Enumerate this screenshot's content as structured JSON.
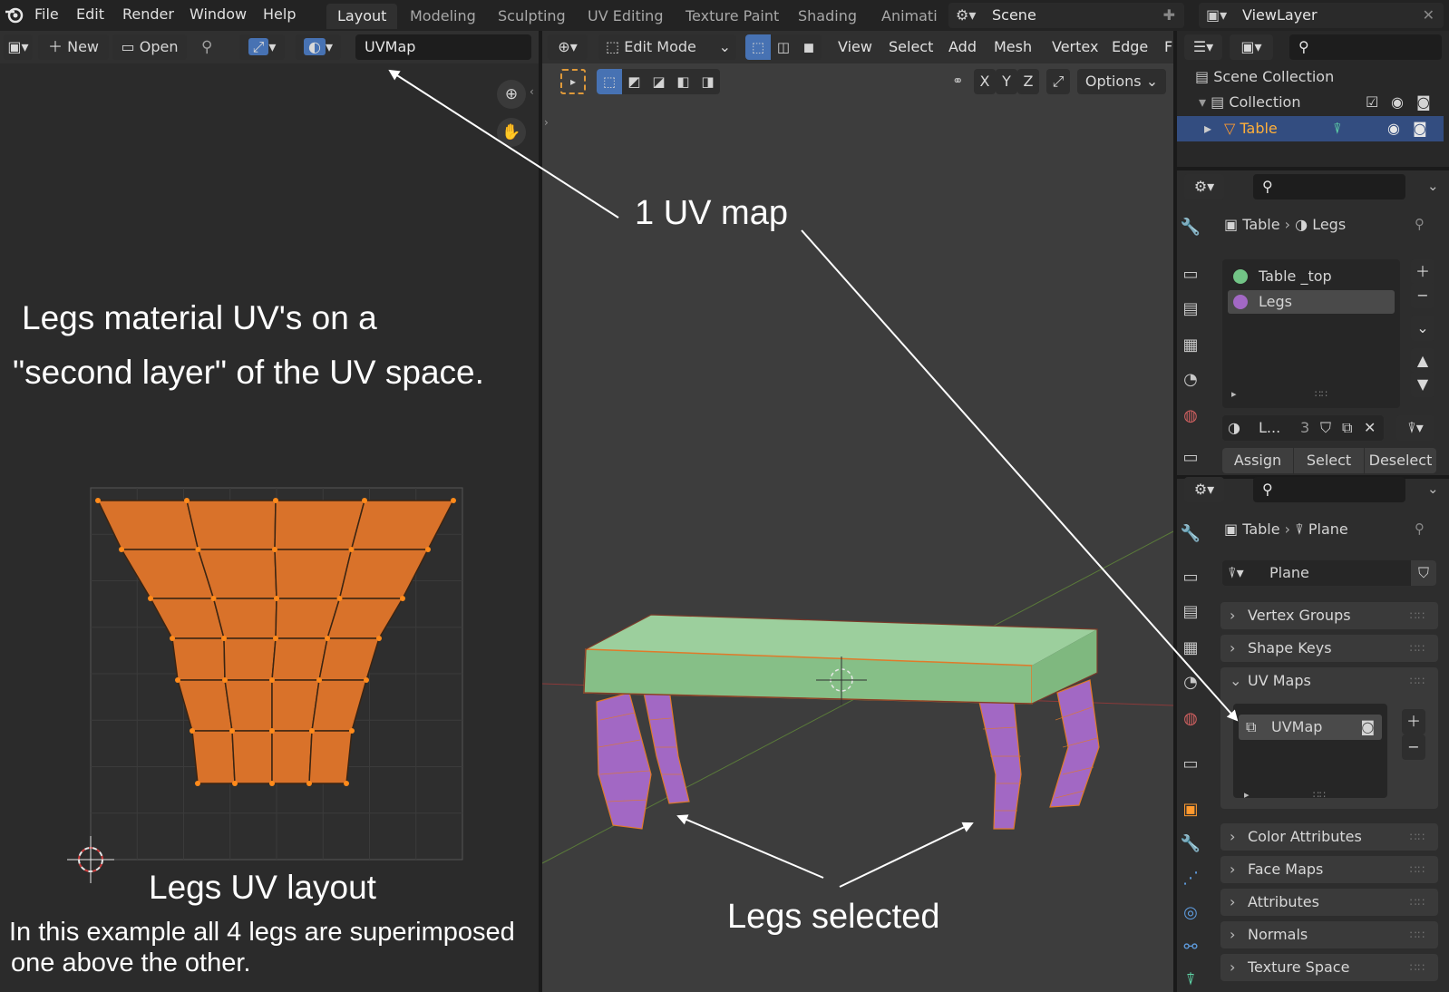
{
  "menu": {
    "file": "File",
    "edit": "Edit",
    "render": "Render",
    "window": "Window",
    "help": "Help"
  },
  "workspaces": [
    "Layout",
    "Modeling",
    "Sculpting",
    "UV Editing",
    "Texture Paint",
    "Shading",
    "Animati"
  ],
  "scene": {
    "label": "Scene"
  },
  "view_layer": {
    "label": "ViewLayer"
  },
  "uv_editor": {
    "new_label": "New",
    "open_label": "Open",
    "uvmap_name": "UVMap"
  },
  "viewport": {
    "mode": "Edit Mode",
    "menus": [
      "View",
      "Select",
      "Add",
      "Mesh",
      "Vertex",
      "Edge",
      "F"
    ],
    "axes": [
      "X",
      "Y",
      "Z"
    ],
    "options_label": "Options"
  },
  "outliner": {
    "scene_collection": "Scene Collection",
    "collection": "Collection",
    "object": "Table"
  },
  "material_panel": {
    "breadcrumb_object": "Table",
    "breadcrumb_material": "Legs",
    "slots": [
      "Table _top",
      "Legs"
    ],
    "material_short": "L...",
    "users": "3",
    "assign": "Assign",
    "select": "Select",
    "deselect": "Deselect"
  },
  "data_panel": {
    "breadcrumb_object": "Table",
    "breadcrumb_mesh": "Plane",
    "mesh_name": "Plane",
    "sections": [
      "Vertex Groups",
      "Shape Keys",
      "UV Maps",
      "Color Attributes",
      "Face Maps",
      "Attributes",
      "Normals",
      "Texture Space"
    ],
    "uv_map_item": "UVMap"
  },
  "annotations": {
    "uv_map_callout": "1 UV map",
    "legs_material_line1": "Legs material UV's on a",
    "legs_material_line2": "\"second layer\" of the UV space.",
    "legs_uv_layout": "Legs UV layout",
    "example_line1": "In this example all 4 legs are superimposed",
    "example_line2": "one above the other.",
    "legs_selected": "Legs selected"
  },
  "colors": {
    "uv_face": "#d9722a",
    "table_top": "#8ec58f",
    "legs": "#a268c4",
    "selection": "#3a5a9a",
    "accent_blue": "#4772b3"
  }
}
